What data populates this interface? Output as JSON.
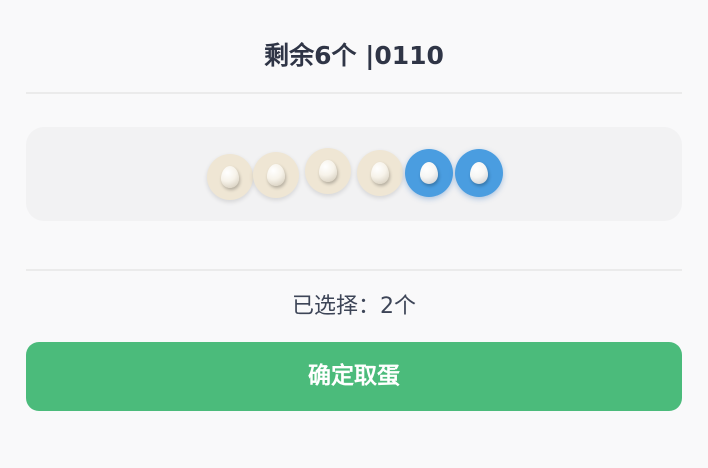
{
  "header": {
    "title": "剩余6个 |0110"
  },
  "eggs": [
    {
      "selected": false
    },
    {
      "selected": false
    },
    {
      "selected": false
    },
    {
      "selected": false
    },
    {
      "selected": true
    },
    {
      "selected": true
    }
  ],
  "status": {
    "selected_text": "已选择：2个"
  },
  "actions": {
    "confirm_label": "确定取蛋"
  },
  "colors": {
    "egg_unselected": "#efe6d4",
    "egg_selected": "#4a9de0",
    "confirm_button": "#4bbb7b"
  }
}
